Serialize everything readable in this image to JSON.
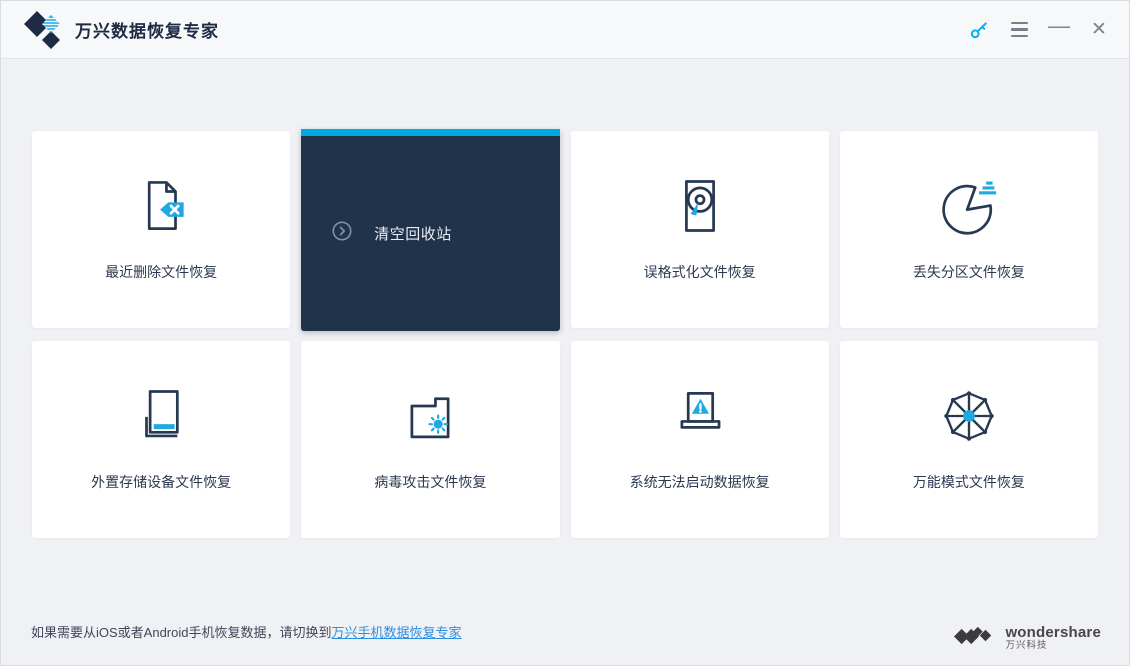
{
  "titlebar": {
    "app_title": "万兴数据恢复专家",
    "minimize_glyph": "—",
    "close_glyph": "✕",
    "icons": [
      "app-logo-diamond",
      "key-icon",
      "hamburger-menu-icon",
      "minimize-icon",
      "close-icon"
    ]
  },
  "cards": [
    {
      "id": "recent-delete",
      "label": "最近删除文件恢复",
      "icon": "file-delete-icon",
      "active": false
    },
    {
      "id": "empty-recycle-bin",
      "label": "清空回收站",
      "icon": "circle-arrow-icon",
      "active": true
    },
    {
      "id": "formatted",
      "label": "误格式化文件恢复",
      "icon": "hard-disk-icon",
      "active": false
    },
    {
      "id": "lost-partition",
      "label": "丢失分区文件恢复",
      "icon": "partition-pie-icon",
      "active": false
    },
    {
      "id": "external-device",
      "label": "外置存储设备文件恢复",
      "icon": "external-drive-icon",
      "active": false
    },
    {
      "id": "virus-attack",
      "label": "病毒攻击文件恢复",
      "icon": "virus-folder-icon",
      "active": false
    },
    {
      "id": "system-crash",
      "label": "系统无法启动数据恢复",
      "icon": "laptop-warning-icon",
      "active": false
    },
    {
      "id": "all-around",
      "label": "万能模式文件恢复",
      "icon": "wheel-icon",
      "active": false
    }
  ],
  "footer": {
    "text_prefix": "如果需要从iOS或者Android手机恢复数据，请切换到",
    "link_label": "万兴手机数据恢复专家"
  },
  "brand": {
    "name": "wondershare",
    "subtitle": "万兴科技"
  },
  "colors": {
    "accent_cyan": "#00a9e0",
    "icon_cyan": "#1fa9e2",
    "navy": "#263852",
    "active_card_bg": "#20334b",
    "link_blue": "#2a8fe0",
    "page_bg": "#f0f1f4"
  }
}
